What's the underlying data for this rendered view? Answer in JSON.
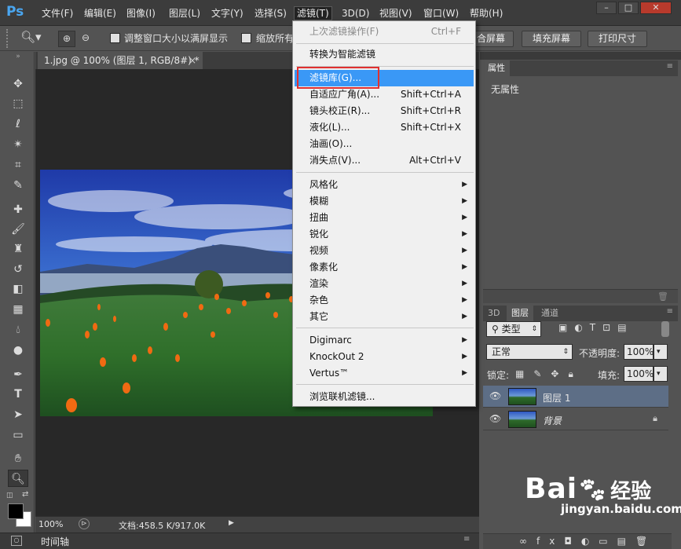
{
  "app": {
    "logo": "Ps"
  },
  "menubar": {
    "items": [
      "文件(F)",
      "编辑(E)",
      "图像(I)",
      "图层(L)",
      "文字(Y)",
      "选择(S)",
      "滤镜(T)",
      "3D(D)",
      "视图(V)",
      "窗口(W)",
      "帮助(H)"
    ],
    "window_buttons": [
      "–",
      "□",
      "✕"
    ]
  },
  "options": {
    "checkbox1_label": "调整窗口大小以满屏显示",
    "checkbox2_label": "缩放所有",
    "btn_fit": "合屏幕",
    "btn_fill": "填充屏幕",
    "btn_print": "打印尺寸"
  },
  "document": {
    "tab_title": "1.jpg @ 100% (图层 1, RGB/8#) *",
    "tab_close": "×",
    "zoom": "100%",
    "doc_info": "文档:458.5 K/917.0K"
  },
  "timeline": {
    "label": "时间轴"
  },
  "filter_menu": {
    "items": [
      {
        "label": "上次滤镜操作(F)",
        "shortcut": "Ctrl+F",
        "disabled": true
      },
      {
        "label": "转换为智能滤镜",
        "shortcut": ""
      },
      {
        "label": "滤镜库(G)...",
        "shortcut": "",
        "highlighted": true
      },
      {
        "label": "自适应广角(A)...",
        "shortcut": "Shift+Ctrl+A"
      },
      {
        "label": "镜头校正(R)...",
        "shortcut": "Shift+Ctrl+R"
      },
      {
        "label": "液化(L)...",
        "shortcut": "Shift+Ctrl+X"
      },
      {
        "label": "油画(O)...",
        "shortcut": ""
      },
      {
        "label": "消失点(V)...",
        "shortcut": "Alt+Ctrl+V"
      },
      {
        "label": "风格化",
        "submenu": true
      },
      {
        "label": "模糊",
        "submenu": true
      },
      {
        "label": "扭曲",
        "submenu": true
      },
      {
        "label": "锐化",
        "submenu": true
      },
      {
        "label": "视频",
        "submenu": true
      },
      {
        "label": "像素化",
        "submenu": true
      },
      {
        "label": "渲染",
        "submenu": true
      },
      {
        "label": "杂色",
        "submenu": true
      },
      {
        "label": "其它",
        "submenu": true
      },
      {
        "label": "Digimarc",
        "submenu": true
      },
      {
        "label": "KnockOut 2",
        "submenu": true
      },
      {
        "label": "Vertus™",
        "submenu": true
      },
      {
        "label": "浏览联机滤镜...",
        "shortcut": ""
      }
    ]
  },
  "properties_panel": {
    "title": "属性",
    "content": "无属性"
  },
  "layers_panel": {
    "tabs": [
      "3D",
      "图层",
      "通道"
    ],
    "kind_filter": "类型",
    "blend_mode": "正常",
    "opacity_label": "不透明度:",
    "opacity_value": "100%",
    "lock_label": "锁定:",
    "fill_label": "填充:",
    "fill_value": "100%",
    "layers": [
      {
        "name": "图层 1",
        "selected": true
      },
      {
        "name": "背景",
        "locked": true
      }
    ]
  },
  "watermark": {
    "text": "Bai",
    "text2": "经验",
    "url": "jingyan.baidu.com"
  },
  "colors": {
    "highlight": "#3a98f6",
    "annotation_box": "#e03030",
    "logo": "#4aa6f0"
  }
}
